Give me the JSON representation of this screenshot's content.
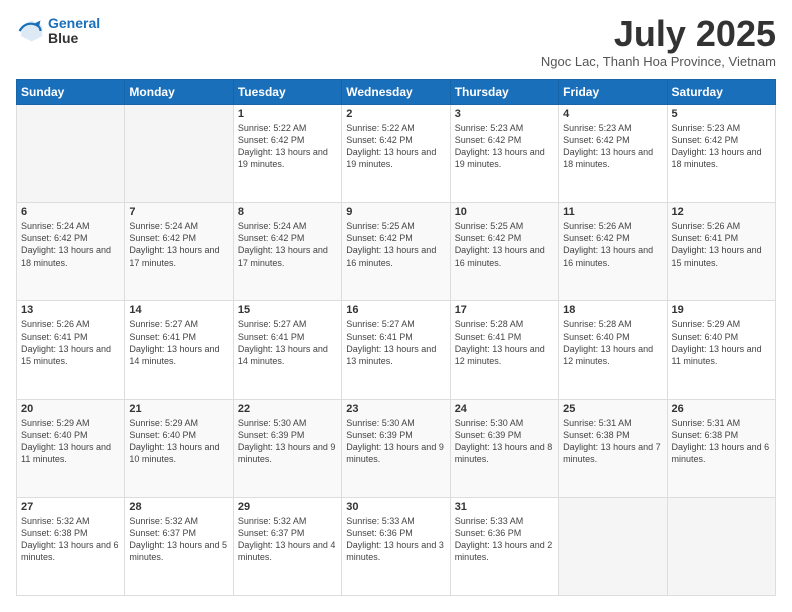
{
  "logo": {
    "line1": "General",
    "line2": "Blue"
  },
  "title": "July 2025",
  "location": "Ngoc Lac, Thanh Hoa Province, Vietnam",
  "days_of_week": [
    "Sunday",
    "Monday",
    "Tuesday",
    "Wednesday",
    "Thursday",
    "Friday",
    "Saturday"
  ],
  "weeks": [
    [
      {
        "day": "",
        "info": ""
      },
      {
        "day": "",
        "info": ""
      },
      {
        "day": "1",
        "info": "Sunrise: 5:22 AM\nSunset: 6:42 PM\nDaylight: 13 hours and 19 minutes."
      },
      {
        "day": "2",
        "info": "Sunrise: 5:22 AM\nSunset: 6:42 PM\nDaylight: 13 hours and 19 minutes."
      },
      {
        "day": "3",
        "info": "Sunrise: 5:23 AM\nSunset: 6:42 PM\nDaylight: 13 hours and 19 minutes."
      },
      {
        "day": "4",
        "info": "Sunrise: 5:23 AM\nSunset: 6:42 PM\nDaylight: 13 hours and 18 minutes."
      },
      {
        "day": "5",
        "info": "Sunrise: 5:23 AM\nSunset: 6:42 PM\nDaylight: 13 hours and 18 minutes."
      }
    ],
    [
      {
        "day": "6",
        "info": "Sunrise: 5:24 AM\nSunset: 6:42 PM\nDaylight: 13 hours and 18 minutes."
      },
      {
        "day": "7",
        "info": "Sunrise: 5:24 AM\nSunset: 6:42 PM\nDaylight: 13 hours and 17 minutes."
      },
      {
        "day": "8",
        "info": "Sunrise: 5:24 AM\nSunset: 6:42 PM\nDaylight: 13 hours and 17 minutes."
      },
      {
        "day": "9",
        "info": "Sunrise: 5:25 AM\nSunset: 6:42 PM\nDaylight: 13 hours and 16 minutes."
      },
      {
        "day": "10",
        "info": "Sunrise: 5:25 AM\nSunset: 6:42 PM\nDaylight: 13 hours and 16 minutes."
      },
      {
        "day": "11",
        "info": "Sunrise: 5:26 AM\nSunset: 6:42 PM\nDaylight: 13 hours and 16 minutes."
      },
      {
        "day": "12",
        "info": "Sunrise: 5:26 AM\nSunset: 6:41 PM\nDaylight: 13 hours and 15 minutes."
      }
    ],
    [
      {
        "day": "13",
        "info": "Sunrise: 5:26 AM\nSunset: 6:41 PM\nDaylight: 13 hours and 15 minutes."
      },
      {
        "day": "14",
        "info": "Sunrise: 5:27 AM\nSunset: 6:41 PM\nDaylight: 13 hours and 14 minutes."
      },
      {
        "day": "15",
        "info": "Sunrise: 5:27 AM\nSunset: 6:41 PM\nDaylight: 13 hours and 14 minutes."
      },
      {
        "day": "16",
        "info": "Sunrise: 5:27 AM\nSunset: 6:41 PM\nDaylight: 13 hours and 13 minutes."
      },
      {
        "day": "17",
        "info": "Sunrise: 5:28 AM\nSunset: 6:41 PM\nDaylight: 13 hours and 12 minutes."
      },
      {
        "day": "18",
        "info": "Sunrise: 5:28 AM\nSunset: 6:40 PM\nDaylight: 13 hours and 12 minutes."
      },
      {
        "day": "19",
        "info": "Sunrise: 5:29 AM\nSunset: 6:40 PM\nDaylight: 13 hours and 11 minutes."
      }
    ],
    [
      {
        "day": "20",
        "info": "Sunrise: 5:29 AM\nSunset: 6:40 PM\nDaylight: 13 hours and 11 minutes."
      },
      {
        "day": "21",
        "info": "Sunrise: 5:29 AM\nSunset: 6:40 PM\nDaylight: 13 hours and 10 minutes."
      },
      {
        "day": "22",
        "info": "Sunrise: 5:30 AM\nSunset: 6:39 PM\nDaylight: 13 hours and 9 minutes."
      },
      {
        "day": "23",
        "info": "Sunrise: 5:30 AM\nSunset: 6:39 PM\nDaylight: 13 hours and 9 minutes."
      },
      {
        "day": "24",
        "info": "Sunrise: 5:30 AM\nSunset: 6:39 PM\nDaylight: 13 hours and 8 minutes."
      },
      {
        "day": "25",
        "info": "Sunrise: 5:31 AM\nSunset: 6:38 PM\nDaylight: 13 hours and 7 minutes."
      },
      {
        "day": "26",
        "info": "Sunrise: 5:31 AM\nSunset: 6:38 PM\nDaylight: 13 hours and 6 minutes."
      }
    ],
    [
      {
        "day": "27",
        "info": "Sunrise: 5:32 AM\nSunset: 6:38 PM\nDaylight: 13 hours and 6 minutes."
      },
      {
        "day": "28",
        "info": "Sunrise: 5:32 AM\nSunset: 6:37 PM\nDaylight: 13 hours and 5 minutes."
      },
      {
        "day": "29",
        "info": "Sunrise: 5:32 AM\nSunset: 6:37 PM\nDaylight: 13 hours and 4 minutes."
      },
      {
        "day": "30",
        "info": "Sunrise: 5:33 AM\nSunset: 6:36 PM\nDaylight: 13 hours and 3 minutes."
      },
      {
        "day": "31",
        "info": "Sunrise: 5:33 AM\nSunset: 6:36 PM\nDaylight: 13 hours and 2 minutes."
      },
      {
        "day": "",
        "info": ""
      },
      {
        "day": "",
        "info": ""
      }
    ]
  ]
}
